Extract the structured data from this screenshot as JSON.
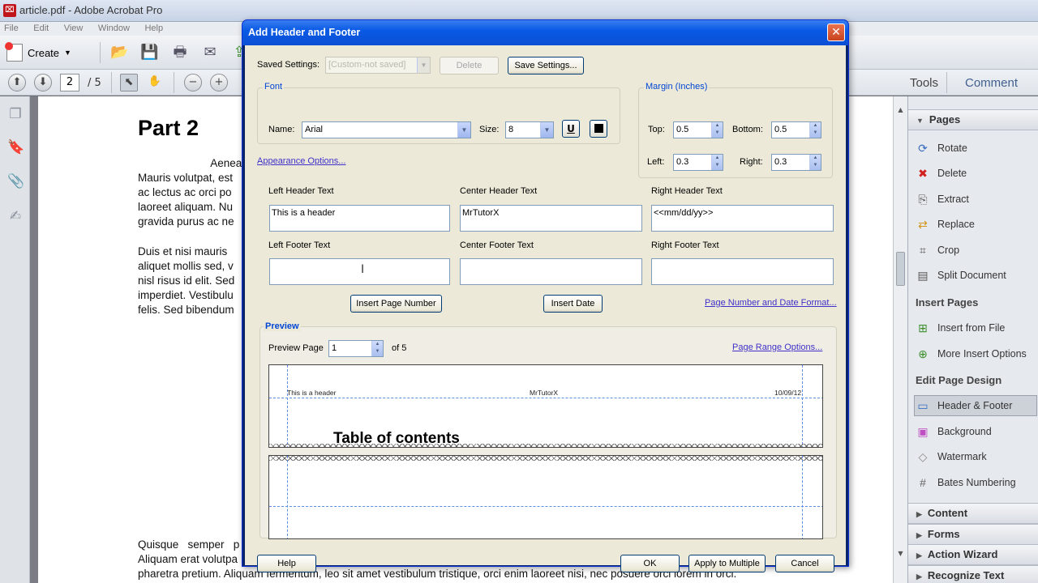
{
  "window": {
    "title": "article.pdf - Adobe Acrobat Pro",
    "app_icon": "acrobat-icon"
  },
  "menu": [
    "File",
    "Edit",
    "View",
    "Window",
    "Help"
  ],
  "toolbar": {
    "create_label": "Create",
    "page_current": "2",
    "page_total": "/ 5",
    "tools_label": "Tools",
    "comment_label": "Comment"
  },
  "document": {
    "heading": "Part 2",
    "lines_a": [
      "                        Aenean n",
      "Mauris volutpat, est",
      "ac lectus ac orci po",
      "laoreet aliquam. Nu",
      "gravida purus ac ne"
    ],
    "lines_b": [
      "Duis et nisi mauris",
      "aliquet mollis sed, v",
      "nisl risus id elit. Sed",
      "imperdiet. Vestibulu",
      "felis. Sed bibendum"
    ],
    "lines_c": [
      "Quisque   semper   p",
      "Aliquam erat volutpa",
      "pharetra pretium. Aliquam fermentum, leo sit amet vestibulum tristique, orci enim laoreet nisi, nec posuere orci lorem in orci."
    ]
  },
  "right_panel": {
    "pages_header": "Pages",
    "pages_items": [
      {
        "label": "Rotate",
        "icon": "rotate-icon"
      },
      {
        "label": "Delete",
        "icon": "delete-icon"
      },
      {
        "label": "Extract",
        "icon": "extract-icon"
      },
      {
        "label": "Replace",
        "icon": "replace-icon"
      },
      {
        "label": "Crop",
        "icon": "crop-icon"
      },
      {
        "label": "Split Document",
        "icon": "split-icon"
      }
    ],
    "insert_group": "Insert Pages",
    "insert_items": [
      {
        "label": "Insert from File",
        "icon": "insert-file-icon"
      },
      {
        "label": "More Insert Options",
        "icon": "more-insert-icon"
      }
    ],
    "design_group": "Edit Page Design",
    "design_items": [
      {
        "label": "Header & Footer",
        "icon": "header-footer-icon"
      },
      {
        "label": "Background",
        "icon": "background-icon"
      },
      {
        "label": "Watermark",
        "icon": "watermark-icon"
      },
      {
        "label": "Bates Numbering",
        "icon": "bates-icon"
      }
    ],
    "collapsed_sections": [
      "Content",
      "Forms",
      "Action Wizard",
      "Recognize Text"
    ]
  },
  "dialog": {
    "title": "Add Header and Footer",
    "saved_settings_label": "Saved Settings:",
    "saved_settings_value": "[Custom-not saved]",
    "delete_label": "Delete",
    "save_settings_label": "Save Settings...",
    "font_group": "Font",
    "name_label": "Name:",
    "font_name": "Arial",
    "size_label": "Size:",
    "font_size": "8",
    "underline_glyph": "U",
    "margin_group": "Margin (Inches)",
    "top_label": "Top:",
    "top_value": "0.5",
    "bottom_label": "Bottom:",
    "bottom_value": "0.5",
    "left_label": "Left:",
    "left_value": "0.3",
    "right_label": "Right:",
    "right_value": "0.3",
    "appearance_link": "Appearance Options...",
    "left_header_label": "Left Header Text",
    "left_header_value": "This is a header",
    "center_header_label": "Center Header Text",
    "center_header_value": "MrTutorX",
    "right_header_label": "Right Header Text",
    "right_header_value": "<<mm/dd/yy>>",
    "left_footer_label": "Left Footer Text",
    "left_footer_value": "",
    "center_footer_label": "Center Footer Text",
    "center_footer_value": "",
    "right_footer_label": "Right Footer Text",
    "right_footer_value": "",
    "insert_page_number_label": "Insert Page Number",
    "insert_date_label": "Insert Date",
    "page_number_format_link": "Page Number and Date Format...",
    "preview_group": "Preview",
    "preview_page_label": "Preview Page",
    "preview_page_value": "1",
    "preview_of": "of 5",
    "page_range_link": "Page Range Options...",
    "preview_header_left": "This is a header",
    "preview_header_center": "MrTutorX",
    "preview_header_right": "10/09/12",
    "preview_content": "Table of contents",
    "help_label": "Help",
    "ok_label": "OK",
    "apply_multiple_label": "Apply to Multiple",
    "cancel_label": "Cancel"
  }
}
